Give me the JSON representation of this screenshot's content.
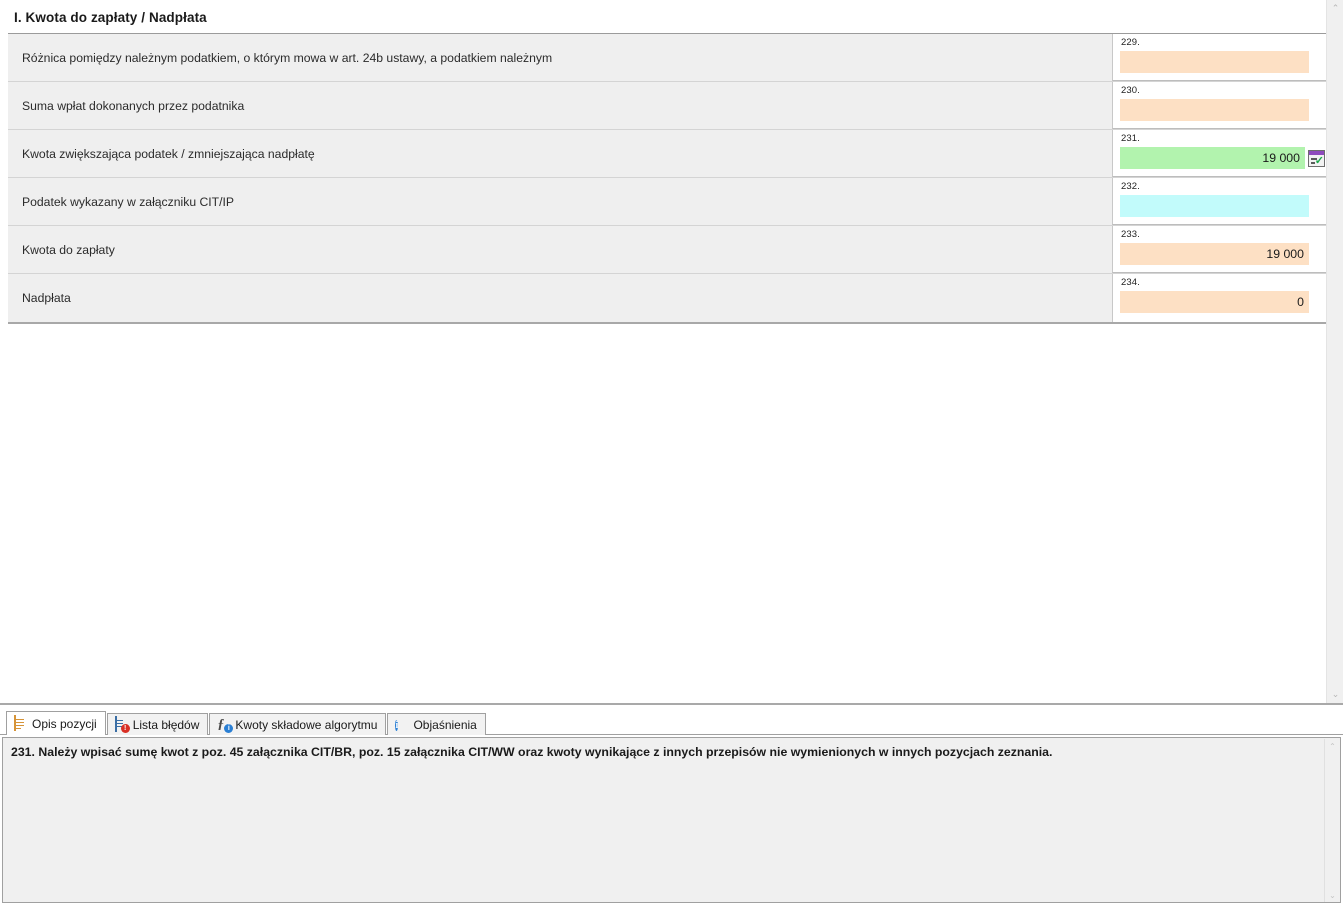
{
  "section": {
    "title": "I. Kwota do zapłaty / Nadpłata"
  },
  "colors": {
    "peach_field": "#fde0c4",
    "green_field": "#b2f3ae",
    "cyan_field": "#c2fbfb",
    "row_bg": "#efefef",
    "accent_purple": "#8e4bbd",
    "badge_red": "#d93025",
    "badge_blue": "#2a7fd4"
  },
  "rows": [
    {
      "label": "Różnica pomiędzy należnym podatkiem, o którym mowa w art. 24b ustawy, a podatkiem należnym",
      "number": "229.",
      "value": "",
      "style": "peach",
      "has_calc_button": false
    },
    {
      "label": "Suma wpłat dokonanych przez podatnika",
      "number": "230.",
      "value": "",
      "style": "peach",
      "has_calc_button": false
    },
    {
      "label": "Kwota zwiększająca podatek / zmniejszająca nadpłatę",
      "number": "231.",
      "value": "19 000",
      "style": "green",
      "has_calc_button": true
    },
    {
      "label": "Podatek wykazany w załączniku CIT/IP",
      "number": "232.",
      "value": "",
      "style": "cyan",
      "has_calc_button": false
    },
    {
      "label": "Kwota do zapłaty",
      "number": "233.",
      "value": "19 000",
      "style": "peach",
      "has_calc_button": false
    },
    {
      "label": "Nadpłata",
      "number": "234.",
      "value": "0",
      "style": "peach",
      "has_calc_button": false
    }
  ],
  "calc_button": {
    "icon": "form-check-icon",
    "check_glyph": "✓"
  },
  "bottom_panel": {
    "tabs": [
      {
        "label": "Opis pozycji",
        "icon": "document-orange-icon",
        "active": true
      },
      {
        "label": "Lista błędów",
        "icon": "document-error-icon",
        "active": false,
        "badge": "!"
      },
      {
        "label": "Kwoty składowe algorytmu",
        "icon": "function-info-icon",
        "active": false,
        "badge": "i",
        "glyph": "ƒ"
      },
      {
        "label": "Objaśnienia",
        "icon": "info-circle-icon",
        "active": false,
        "glyph": "i"
      }
    ],
    "description": "231. Należy wpisać sumę kwot z poz. 45 załącznika CIT/BR, poz. 15 załącznika CIT/WW oraz kwoty wynikające z innych przepisów nie wymienionych w innych pozycjach zeznania."
  },
  "scrollbars": {
    "up_glyph": "⌃",
    "down_glyph": "⌄"
  }
}
